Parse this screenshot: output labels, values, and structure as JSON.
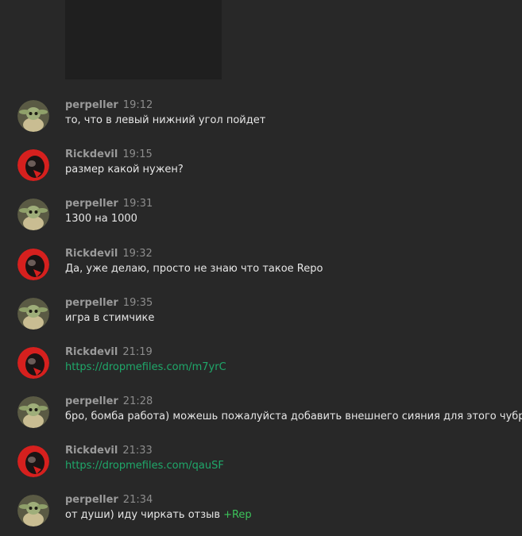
{
  "messages": [
    {
      "author": "perpeller",
      "time": "19:12",
      "text": "то, что в левый нижний угол пойдет",
      "avatar": "yoda-avatar"
    },
    {
      "author": "Rickdevil",
      "time": "19:15",
      "text": "размер какой нужен?",
      "avatar": "skull-red-avatar"
    },
    {
      "author": "perpeller",
      "time": "19:31",
      "text": "1300 на 1000",
      "avatar": "yoda-avatar"
    },
    {
      "author": "Rickdevil",
      "time": "19:32",
      "text": "Да, уже делаю, просто не знаю что такое Repo",
      "avatar": "skull-red-avatar"
    },
    {
      "author": "perpeller",
      "time": "19:35",
      "text": "игра в стимчике",
      "avatar": "yoda-avatar"
    },
    {
      "author": "Rickdevil",
      "time": "21:19",
      "link": "https://dropmefiles.com/m7yrC",
      "avatar": "skull-red-avatar"
    },
    {
      "author": "perpeller",
      "time": "21:28",
      "text": "бро, бомба работа) можешь пожалуйста добавить внешнего сияния для этого чубрика",
      "avatar": "yoda-avatar"
    },
    {
      "author": "Rickdevil",
      "time": "21:33",
      "link": "https://dropmefiles.com/qauSF",
      "avatar": "skull-red-avatar"
    },
    {
      "author": "perpeller",
      "time": "21:34",
      "text": "от души) иду чиркать отзыв",
      "tag": "+Rep",
      "avatar": "yoda-avatar"
    }
  ],
  "colors": {
    "background": "#282828",
    "link": "#1fa86a",
    "rep": "#3cc35a",
    "author": "#9a9a9a"
  }
}
